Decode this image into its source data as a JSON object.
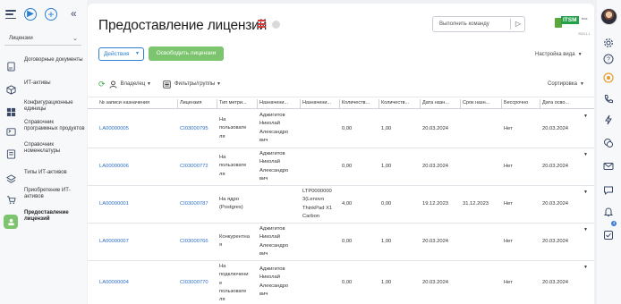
{
  "sidebar": {
    "section_select": "Лицензии",
    "items": [
      {
        "label": "Договорные документы",
        "icon": "contract-doc-icon"
      },
      {
        "label": "ИТ-активы",
        "icon": "cube-icon"
      },
      {
        "label": "Конфигурационные единицы",
        "icon": "windows-grid-icon"
      },
      {
        "label": "Справочник программных продуктов",
        "icon": "software-catalog-icon"
      },
      {
        "label": "Справочник номенклатуры",
        "icon": "nomenclature-icon"
      },
      {
        "label": "Типы ИТ-активов",
        "icon": "asset-types-icon"
      },
      {
        "label": "Приобретение ИТ-активов",
        "icon": "cart-icon"
      },
      {
        "label": "Предоставление лицензий",
        "icon": "license-grant-icon",
        "active": true
      }
    ]
  },
  "header": {
    "title": "Предоставление лицензий",
    "command_placeholder": "Выполнить команду",
    "logo_text": "ITSM",
    "logo_sub": "box",
    "logo_version": "2024.1.1"
  },
  "toolbar": {
    "actions_label": "Действия",
    "release_label": "Освободить лицензии",
    "view_settings_label": "Настройка вида"
  },
  "filters": {
    "owner_label": "Владелец",
    "filters_label": "Фильтры/группы",
    "sort_label": "Сортировка"
  },
  "table": {
    "columns": [
      "№ записи назначения",
      "Лицензия",
      "Тип метри...",
      "Назначени...",
      "Назначени...",
      "Количеств...",
      "Количеств...",
      "Дата назн...",
      "Срок назн...",
      "Бессрочно",
      "Дата осво..."
    ],
    "rows": [
      {
        "num": "LA00000005",
        "license": "CI03000795",
        "metric": [
          "На",
          "пользовате",
          "ля"
        ],
        "assignee": [
          "Аджигитов",
          "Николай",
          "Александро",
          "вич"
        ],
        "assignee2": [],
        "qty1": "0,00",
        "qty2": "1,00",
        "date": "20.03.2024",
        "term": "",
        "perpetual": "Нет",
        "release": "20.03.2024"
      },
      {
        "num": "LA00000006",
        "license": "CI03000772",
        "metric": [
          "На",
          "пользовате",
          "ля"
        ],
        "assignee": [
          "Аджигитов",
          "Николай",
          "Александро",
          "вич"
        ],
        "assignee2": [],
        "qty1": "0,00",
        "qty2": "1,00",
        "date": "20.03.2024",
        "term": "",
        "perpetual": "Нет",
        "release": "20.03.2024"
      },
      {
        "num": "LA00000001",
        "license": "CI03000787",
        "metric": [
          "На ядро",
          "(Postgres)"
        ],
        "assignee": [],
        "assignee2": [
          "LTP0000000",
          "3(Lenovo",
          "ThinkPad X1",
          "Carbon"
        ],
        "qty1": "4,00",
        "qty2": "0,00",
        "date": "19.12.2023",
        "term": "31.12.2023",
        "perpetual": "Нет",
        "release": "20.03.2024"
      },
      {
        "num": "LA00000007",
        "license": "CI03000766",
        "metric": [
          "Конкурентна",
          "я"
        ],
        "assignee": [
          "Аджигитов",
          "Николай",
          "Александро",
          "вич"
        ],
        "assignee2": [],
        "qty1": "0,00",
        "qty2": "1,00",
        "date": "20.03.2024",
        "term": "",
        "perpetual": "Нет",
        "release": "20.03.2024"
      },
      {
        "num": "LA00000004",
        "license": "CI03000770",
        "metric": [
          "На",
          "подключени",
          "е",
          "пользовате",
          "ля"
        ],
        "assignee": [
          "Аджигитов",
          "Николай",
          "Александро",
          "вич"
        ],
        "assignee2": [],
        "qty1": "0,00",
        "qty2": "1,00",
        "date": "20.03.2024",
        "term": "",
        "perpetual": "Нет",
        "release": "20.03.2024"
      }
    ]
  },
  "right_rail": {
    "icons": [
      "settings-icon",
      "help-icon",
      "sun-icon",
      "phone-icon",
      "lightning-icon",
      "chat-bubbles-icon",
      "mail-icon",
      "message-icon",
      "bell-icon",
      "task-check-icon"
    ],
    "badge_count": "4"
  },
  "colors": {
    "accent": "#2a7fd0",
    "green": "#7cc46d",
    "link": "#2a6ec6"
  }
}
